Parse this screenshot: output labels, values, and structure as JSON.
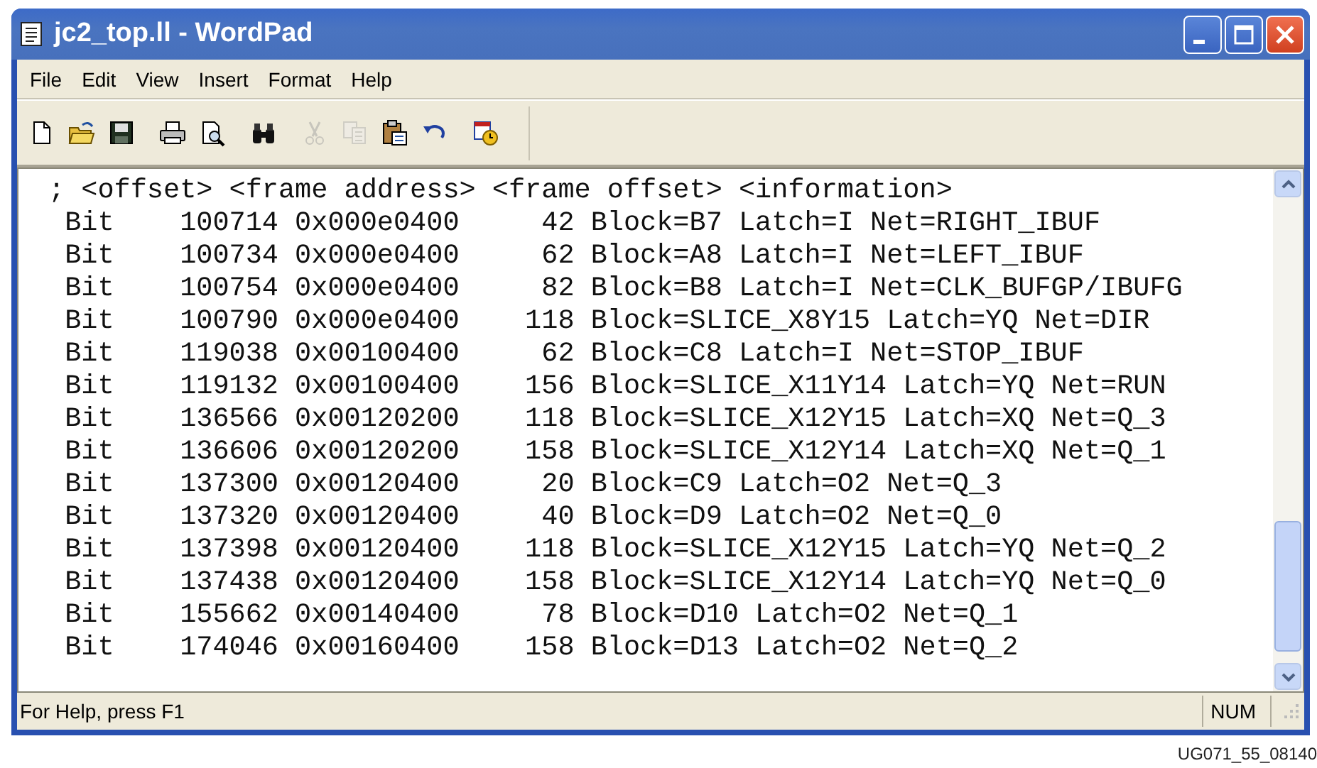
{
  "window": {
    "title": "jc2_top.ll - WordPad"
  },
  "menu": [
    "File",
    "Edit",
    "View",
    "Insert",
    "Format",
    "Help"
  ],
  "toolbar": [
    {
      "disabled": false
    },
    {
      "disabled": false
    },
    {
      "disabled": false
    },
    {
      "disabled": false
    },
    {
      "disabled": false
    },
    {
      "disabled": false
    },
    {
      "disabled": true
    },
    {
      "disabled": true
    },
    {
      "disabled": false
    },
    {
      "disabled": false
    },
    {
      "disabled": false
    }
  ],
  "document": {
    "lines": [
      "; <offset> <frame address> <frame offset> <information>",
      " Bit    100714 0x000e0400     42 Block=B7 Latch=I Net=RIGHT_IBUF",
      " Bit    100734 0x000e0400     62 Block=A8 Latch=I Net=LEFT_IBUF",
      " Bit    100754 0x000e0400     82 Block=B8 Latch=I Net=CLK_BUFGP/IBUFG",
      " Bit    100790 0x000e0400    118 Block=SLICE_X8Y15 Latch=YQ Net=DIR",
      " Bit    119038 0x00100400     62 Block=C8 Latch=I Net=STOP_IBUF",
      " Bit    119132 0x00100400    156 Block=SLICE_X11Y14 Latch=YQ Net=RUN",
      " Bit    136566 0x00120200    118 Block=SLICE_X12Y15 Latch=XQ Net=Q_3",
      " Bit    136606 0x00120200    158 Block=SLICE_X12Y14 Latch=XQ Net=Q_1",
      " Bit    137300 0x00120400     20 Block=C9 Latch=O2 Net=Q_3",
      " Bit    137320 0x00120400     40 Block=D9 Latch=O2 Net=Q_0",
      " Bit    137398 0x00120400    118 Block=SLICE_X12Y15 Latch=YQ Net=Q_2",
      " Bit    137438 0x00120400    158 Block=SLICE_X12Y14 Latch=YQ Net=Q_0",
      " Bit    155662 0x00140400     78 Block=D10 Latch=O2 Net=Q_1",
      " Bit    174046 0x00160400    158 Block=D13 Latch=O2 Net=Q_2"
    ]
  },
  "status_bar": {
    "message": "For Help, press F1",
    "indicator": "NUM"
  },
  "figure_id": "UG071_55_08140"
}
